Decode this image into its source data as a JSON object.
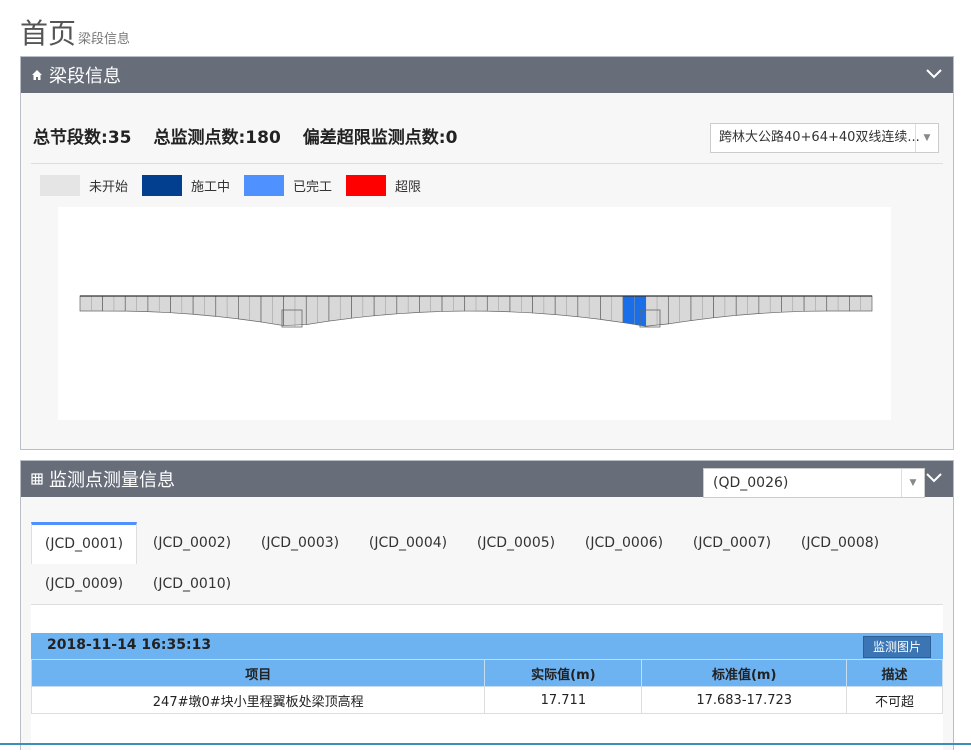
{
  "page": {
    "title": "首页",
    "subtitle": "梁段信息"
  },
  "segment_panel": {
    "title": "梁段信息",
    "stats": [
      {
        "label": "总节段数:",
        "value": "35"
      },
      {
        "label": "总监测点数:",
        "value": "180"
      },
      {
        "label": "偏差超限监测点数:",
        "value": "0"
      }
    ],
    "bridge_select": "跨林大公路40+64+40双线连续...",
    "legend": [
      {
        "label": "未开始",
        "color": "#e5e5e5"
      },
      {
        "label": "施工中",
        "color": "#023f8f"
      },
      {
        "label": "已完工",
        "color": "#4f91ff"
      },
      {
        "label": "超限",
        "color": "#ff0000"
      }
    ],
    "bridge": {
      "segment_count": 35,
      "active_segment": 25,
      "active_color": "#1a6ee8",
      "default_color": "#d8d8d8"
    }
  },
  "measure_panel": {
    "title": "监测点测量信息",
    "point_select": "(QD_0026)",
    "tabs": [
      "(JCD_0001)",
      "(JCD_0002)",
      "(JCD_0003)",
      "(JCD_0004)",
      "(JCD_0005)",
      "(JCD_0006)",
      "(JCD_0007)",
      "(JCD_0008)",
      "(JCD_0009)",
      "(JCD_0010)"
    ],
    "active_tab": 0,
    "record": {
      "datetime": "2018-11-14 16:35:13",
      "photo_button": "监测图片",
      "columns": [
        "项目",
        "实际值(m)",
        "标准值(m)",
        "描述"
      ],
      "rows": [
        [
          "247#墩0#块小里程翼板处梁顶高程",
          "17.711",
          "17.683-17.723",
          "不可超"
        ]
      ]
    }
  }
}
